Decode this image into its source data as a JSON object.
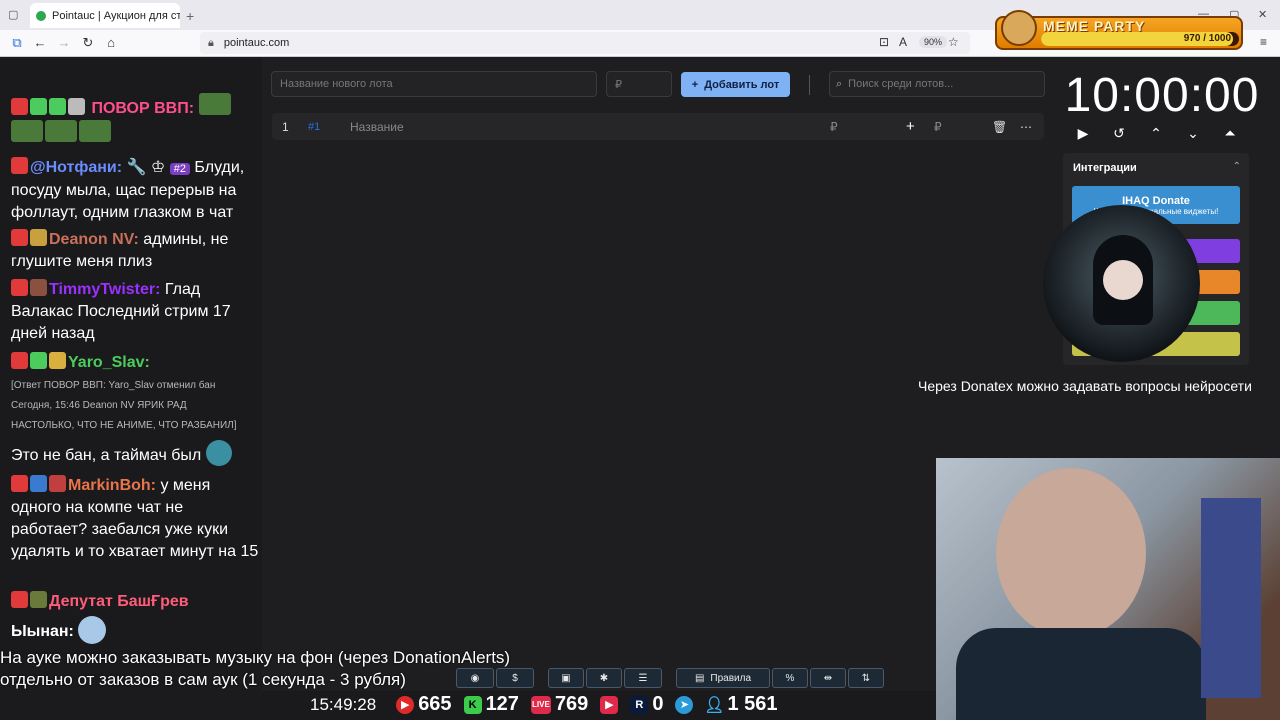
{
  "browser": {
    "tab_title": "Pointauc | Аукцион для стримо",
    "url": "pointauc.com",
    "zoom": "90%"
  },
  "meme_party": {
    "title": "MEME PARTY",
    "counter": "970 / 1000",
    "progress": 0.97
  },
  "auction": {
    "new_lot_placeholder": "Название нового лота",
    "price_placeholder": "₽",
    "add_button": "Добавить лот",
    "search_placeholder": "Поиск среди лотов...",
    "lot": {
      "index": "1",
      "id": "#1",
      "name": "Название",
      "currency": "₽",
      "plus_currency": "₽"
    },
    "timer": "10:00:00"
  },
  "integrations": {
    "header": "Интеграции",
    "buttons": [
      {
        "label": "IHAQ Donate",
        "sub": "Кастомные уникальные виджеты!",
        "color": "#3a8fd0"
      },
      {
        "label": "",
        "sub": "",
        "color": "#7f3fe0"
      },
      {
        "label": "",
        "sub": "",
        "color": "#e8862a"
      },
      {
        "label": "",
        "sub": "",
        "color": "#4cb85a"
      },
      {
        "label": "uet",
        "sub": "",
        "color": "#c5c24a"
      }
    ]
  },
  "donatex_text": "Через Donatex можно задавать вопросы нейросети",
  "chat": {
    "messages": [
      {
        "user": "ПОВОР ВВП:",
        "user_color": "#ff4f8b",
        "text": ""
      },
      {
        "user": "@Нотфани:",
        "user_color": "#6b8cff",
        "text": "Блуди, посуду мыла, щас перерыв на фоллаут, одним глазком в чат",
        "badge": "#2"
      },
      {
        "user": "Deanon NV:",
        "user_color": "#c9705a",
        "text": "админы, не глушите меня плиз"
      },
      {
        "user": "TimmyTwister:",
        "user_color": "#9b30ff",
        "text": "Глад Валакас Последний стрим 17 дней назад"
      },
      {
        "user": "Yaro_Slav:",
        "user_color": "#4ccc5c",
        "text": ""
      },
      {
        "user": "",
        "user_color": "#fff",
        "text": "Это не бан, а таймач был"
      },
      {
        "user": "MarkinBoh:",
        "user_color": "#e8744a",
        "text": "у меня одного на компе чат не работает? заебался уже куки удалять и то хватает минут на 15"
      },
      {
        "user": "Депутат БашҒрев",
        "user_color": "#ff5c7a",
        "text": ""
      },
      {
        "user": "Ыынан:",
        "user_color": "#fff",
        "text": ""
      }
    ],
    "system_lines": [
      "[Ответ ПОВОР ВВП: Yaro_Slav отменил бан",
      "Сегодня, 15:46 Deanon NV  ЯРИК РАД",
      "НАСТОЛЬКО, ЧТО НЕ АНИМЕ, ЧТО РАЗБАНИЛ]"
    ]
  },
  "music_text": "На ауке можно заказывать музыку на фон (через DonationAlerts)\nотдельно от заказов в сам аук (1 секунда - 3 рубля)",
  "toolbar": {
    "rules": "Правила"
  },
  "stats": {
    "clock": "15:49:28",
    "youtube": "665",
    "kick": "127",
    "live": "769",
    "rutube": "0",
    "viewers": "1 561"
  }
}
